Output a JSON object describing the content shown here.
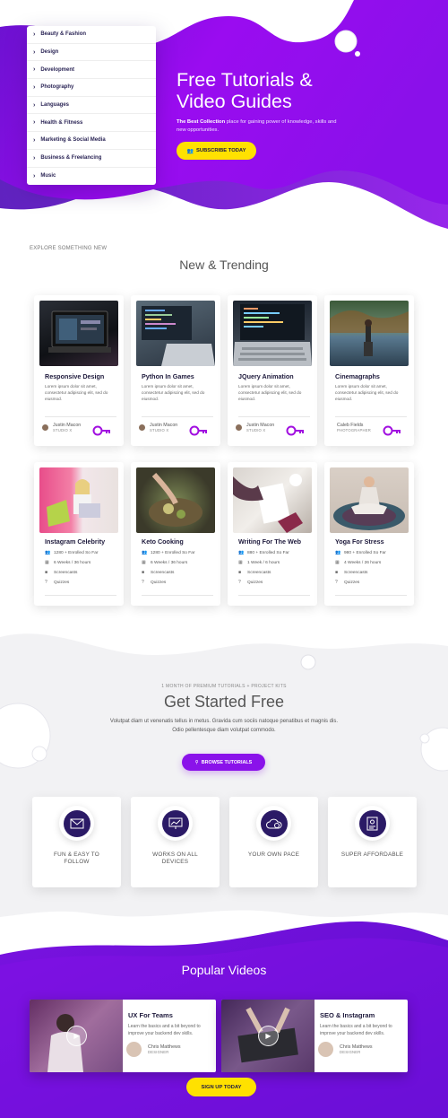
{
  "hero": {
    "categories": [
      "Beauty & Fashion",
      "Design",
      "Development",
      "Photography",
      "Languages",
      "Health & Fitness",
      "Marketing & Social Media",
      "Business & Freelancing",
      "Music"
    ],
    "title_line1": "Free Tutorials &",
    "title_line2": "Video Guides",
    "desc_bold": "The Best Collection",
    "desc_rest": " place for gaining power of knowledge, skills and new opportunities.",
    "subscribe_label": "SUBSCRIBE TODAY"
  },
  "trending": {
    "kicker": "EXPLORE SOMETHING NEW",
    "title": "New & Trending",
    "courses": [
      {
        "title": "Responsive Design",
        "desc": "Lorem ipsum dolor sit amet, consectetur adipiscing elit, sed do eiusmod.",
        "author": "Justin Macon",
        "role": "STUDIO X"
      },
      {
        "title": "Python In Games",
        "desc": "Lorem ipsum dolor sit amet, consectetur adipiscing elit, sed do eiusmod.",
        "author": "Justin Macon",
        "role": "STUDIO X"
      },
      {
        "title": "JQuery Animation",
        "desc": "Lorem ipsum dolor sit amet, consectetur adipiscing elit, sed do eiusmod.",
        "author": "Justin Macon",
        "role": "STUDIO X"
      },
      {
        "title": "Cinemagraphs",
        "desc": "Lorem ipsum dolor sit amet, consectetur adipiscing elit, sed do eiusmod.",
        "author": "Caleb Fields",
        "role": "PHOTOGRAPHER"
      }
    ],
    "courses2": [
      {
        "title": "Instagram Celebrity",
        "enrolled": "1280 + Enrolled So Far",
        "duration": "6 Weeks / 36 hours",
        "screencasts": "Screencasts",
        "quizzes": "Quizzes"
      },
      {
        "title": "Keto Cooking",
        "enrolled": "1280 + Enrolled So Far",
        "duration": "6 Weeks / 36 hours",
        "screencasts": "Screencasts",
        "quizzes": "Quizzes"
      },
      {
        "title": "Writing For The Web",
        "enrolled": "880 + Enrolled So Far",
        "duration": "1 Week / 6 hours",
        "screencasts": "Screencasts",
        "quizzes": "Quizzes"
      },
      {
        "title": "Yoga For Stress",
        "enrolled": "980 + Enrolled So Far",
        "duration": "4 Weeks / 26 hours",
        "screencasts": "Screencasts",
        "quizzes": "Quizzes"
      }
    ]
  },
  "started": {
    "kicker": "1 MONTH OF PREMIUM TUTORIALS + PROJECT KITS",
    "title": "Get Started Free",
    "desc": "Volutpat diam ut venenatis tellus in metus. Gravida cum sociis natoque penatibus et magnis dis. Odio pellentesque diam volutpat commodo.",
    "button": "BROWSE TUTORIALS",
    "features": [
      "FUN & EASY TO FOLLOW",
      "WORKS ON ALL DEVICES",
      "YOUR OWN PACE",
      "SUPER AFFORDABLE"
    ]
  },
  "popular": {
    "title": "Popular Videos",
    "videos": [
      {
        "title": "UX For Teams",
        "desc": "Learn the basics and a bit beyond to improve your backend dev skills.",
        "author": "Chris Matthews",
        "role": "DESIGNER"
      },
      {
        "title": "SEO & Instagram",
        "desc": "Learn the basics and a bit beyond to improve your backend dev skills.",
        "author": "Chris Matthews",
        "role": "DESIGNER"
      }
    ],
    "signup": "SIGN UP TODAY"
  },
  "colors": {
    "purple": "#8a12ea",
    "deep_purple": "#5a0fd6",
    "yellow": "#ffe100",
    "navy": "#1e1a44"
  }
}
